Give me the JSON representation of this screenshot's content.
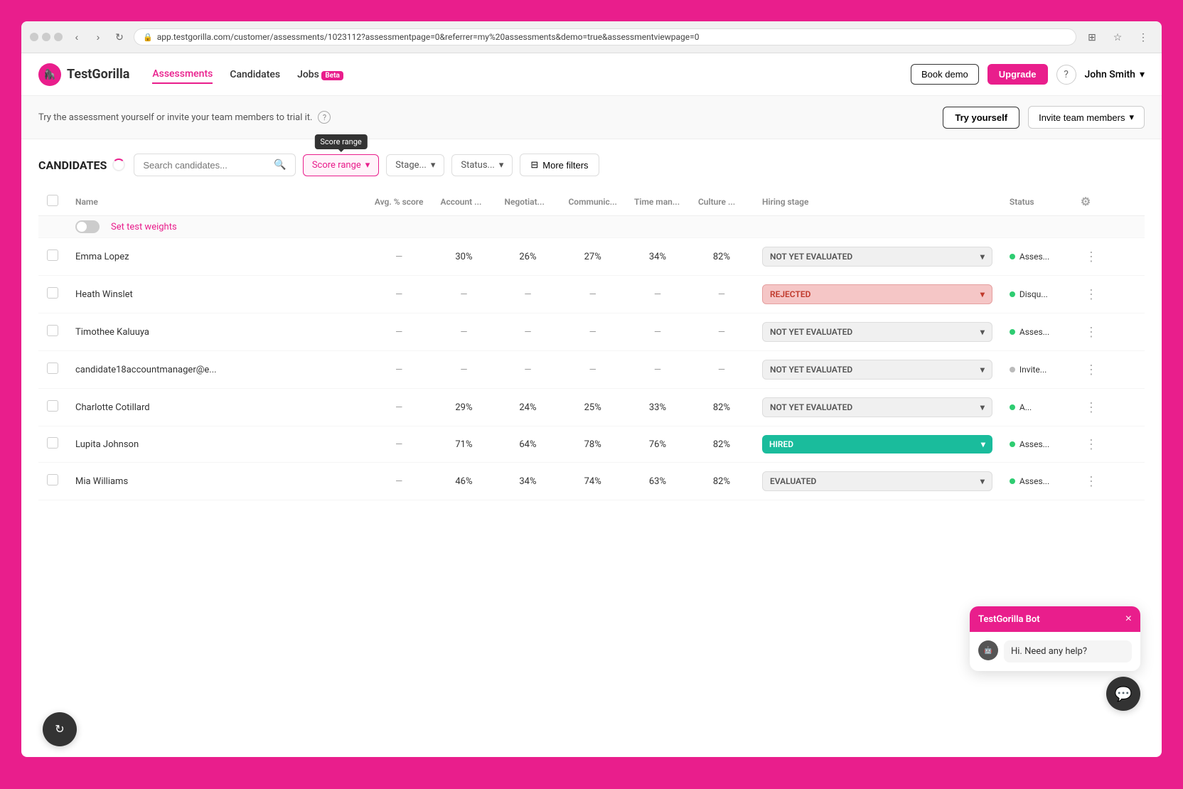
{
  "browser": {
    "url": "app.testgorilla.com/customer/assessments/1023112?assessmentpage=0&referrer=my%20assessments&demo=true&assessmentviewpage=0",
    "url_icon": "🔒"
  },
  "nav": {
    "logo_text": "TestGorilla",
    "links": [
      {
        "label": "Assessments",
        "active": true
      },
      {
        "label": "Candidates",
        "active": false
      },
      {
        "label": "Jobs",
        "active": false,
        "beta": true
      }
    ],
    "book_demo": "Book demo",
    "upgrade": "Upgrade",
    "user_name": "John Smith"
  },
  "trial_banner": {
    "text": "Try the assessment yourself or invite your team members to trial it.",
    "try_label": "Try yourself",
    "invite_label": "Invite team members"
  },
  "candidates": {
    "title": "CANDIDATES",
    "search_placeholder": "Search candidates...",
    "score_range_label": "Score range",
    "stage_placeholder": "Stage...",
    "status_placeholder": "Status...",
    "more_filters_label": "More filters",
    "set_test_weights_label": "Set test weights",
    "tooltip_text": "Score range",
    "columns": {
      "name": "Name",
      "avg_score": "Avg. % score",
      "account": "Account ...",
      "negotiate": "Negotiat...",
      "communicate": "Communic...",
      "time_man": "Time man...",
      "culture": "Culture ...",
      "hiring_stage": "Hiring stage",
      "status": "Status"
    },
    "rows": [
      {
        "id": 1,
        "name": "Emma Lopez",
        "avg_score": "—",
        "account": "30%",
        "negotiate": "26%",
        "communicate": "27%",
        "time_man": "34%",
        "culture": "82%",
        "hiring_stage": "NOT YET EVALUATED",
        "stage_class": "stage-not-evaluated",
        "status_label": "Asses...",
        "status_dot": "dot-green"
      },
      {
        "id": 2,
        "name": "Heath Winslet",
        "avg_score": "—",
        "account": "—",
        "negotiate": "—",
        "communicate": "—",
        "time_man": "—",
        "culture": "—",
        "hiring_stage": "REJECTED",
        "stage_class": "stage-rejected",
        "status_label": "Disqu...",
        "status_dot": "dot-green"
      },
      {
        "id": 3,
        "name": "Timothee Kaluuya",
        "avg_score": "—",
        "account": "—",
        "negotiate": "—",
        "communicate": "—",
        "time_man": "—",
        "culture": "—",
        "hiring_stage": "NOT YET EVALUATED",
        "stage_class": "stage-not-evaluated",
        "status_label": "Asses...",
        "status_dot": "dot-green"
      },
      {
        "id": 4,
        "name": "candidate18accountmanager@e...",
        "avg_score": "—",
        "account": "—",
        "negotiate": "—",
        "communicate": "—",
        "time_man": "—",
        "culture": "—",
        "hiring_stage": "NOT YET EVALUATED",
        "stage_class": "stage-not-evaluated",
        "status_label": "Invite...",
        "status_dot": "dot-gray"
      },
      {
        "id": 5,
        "name": "Charlotte Cotillard",
        "avg_score": "—",
        "account": "29%",
        "negotiate": "24%",
        "communicate": "25%",
        "time_man": "33%",
        "culture": "82%",
        "hiring_stage": "NOT YET EVALUATED",
        "stage_class": "stage-not-evaluated",
        "status_label": "A...",
        "status_dot": "dot-green"
      },
      {
        "id": 6,
        "name": "Lupita Johnson",
        "avg_score": "—",
        "account": "71%",
        "negotiate": "64%",
        "communicate": "78%",
        "time_man": "76%",
        "culture": "82%",
        "hiring_stage": "HIRED",
        "stage_class": "stage-hired",
        "status_label": "Asses...",
        "status_dot": "dot-green"
      },
      {
        "id": 7,
        "name": "Mia Williams",
        "avg_score": "—",
        "account": "46%",
        "negotiate": "34%",
        "communicate": "74%",
        "time_man": "63%",
        "culture": "82%",
        "hiring_stage": "EVALUATED",
        "stage_class": "stage-evaluated",
        "status_label": "Asses...",
        "status_dot": "dot-green"
      }
    ]
  },
  "chat": {
    "bot_name": "TestGorilla Bot",
    "message": "Hi. Need any help?",
    "close_icon": "×"
  },
  "icons": {
    "search": "🔍",
    "chevron_down": "▾",
    "filter": "⊟",
    "help": "?",
    "settings_cog": "⚙",
    "more_vertical": "⋮",
    "chat_icon": "💬",
    "cw_icon": "↻"
  }
}
